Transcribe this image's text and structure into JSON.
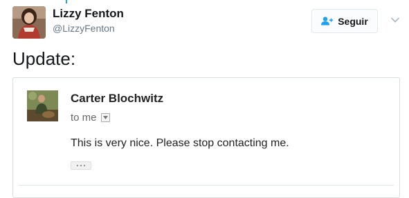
{
  "tweet": {
    "author": {
      "display_name": "Lizzy Fenton",
      "handle": "@LizzyFenton",
      "avatar_icon": "profile-photo"
    },
    "follow_button": {
      "label": "Seguir",
      "icon": "add-user-icon",
      "accent": "#1da1f2"
    },
    "menu_icon": "chevron-down-icon",
    "text": "Update:"
  },
  "email": {
    "sender_name": "Carter Blochwitz",
    "recipient": "to me",
    "body": "This is very nice. Please stop contacting me.",
    "trimmed_icon": "ellipsis-icon"
  }
}
